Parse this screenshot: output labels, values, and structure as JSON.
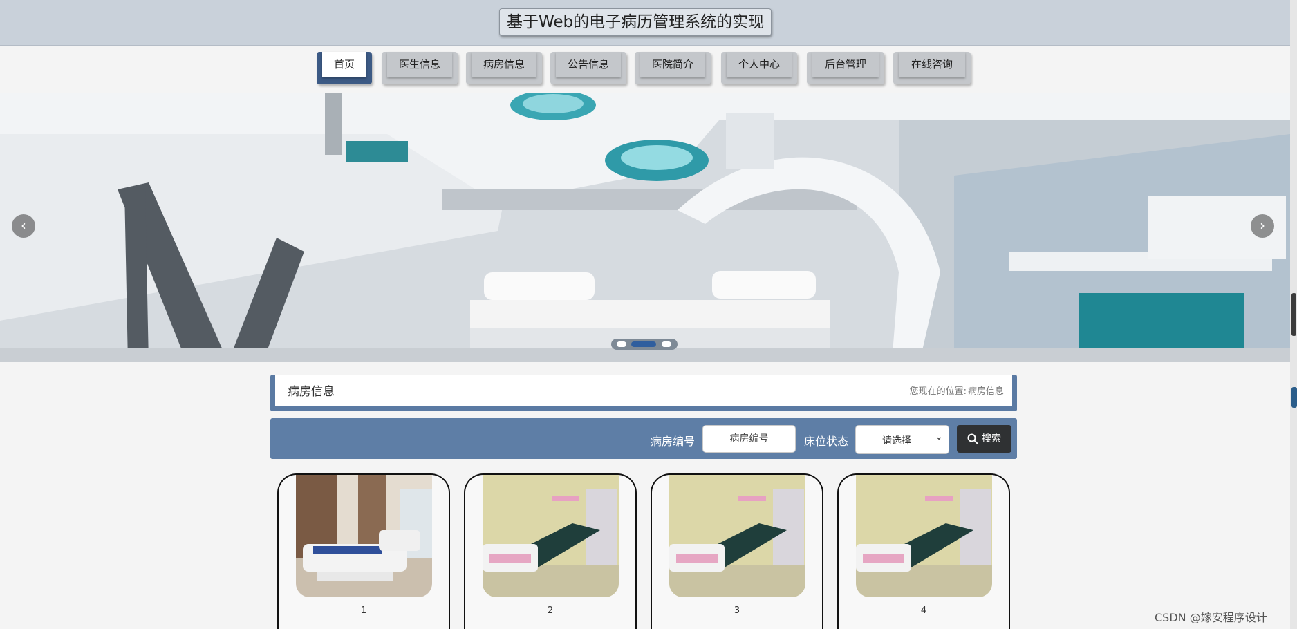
{
  "header": {
    "title": "基于Web的电子病历管理系统的实现"
  },
  "nav": {
    "items": [
      {
        "label": "首页",
        "active": true
      },
      {
        "label": "医生信息",
        "active": false
      },
      {
        "label": "病房信息",
        "active": false
      },
      {
        "label": "公告信息",
        "active": false
      },
      {
        "label": "医院简介",
        "active": false
      },
      {
        "label": "个人中心",
        "active": false
      },
      {
        "label": "后台管理",
        "active": false
      },
      {
        "label": "在线咨询",
        "active": false
      }
    ]
  },
  "banner": {
    "active_slide": 2,
    "slide_count": 3,
    "prev_icon": "chevron-left-icon",
    "next_icon": "chevron-right-icon"
  },
  "section": {
    "title": "病房信息",
    "location_label": "您现在的位置:",
    "location_value": "病房信息"
  },
  "search": {
    "room_label": "病房编号",
    "room_placeholder": "病房编号",
    "status_label": "床位状态",
    "status_selected": "请选择",
    "button_label": "搜索",
    "button_icon": "search-icon"
  },
  "rooms": [
    {
      "label": "1"
    },
    {
      "label": "2"
    },
    {
      "label": "3"
    },
    {
      "label": "4"
    }
  ],
  "watermark": "CSDN @嫁安程序设计",
  "colors": {
    "accent": "#5e7ea6",
    "nav_active": "#3c5a85",
    "search_button": "#2f3133"
  }
}
